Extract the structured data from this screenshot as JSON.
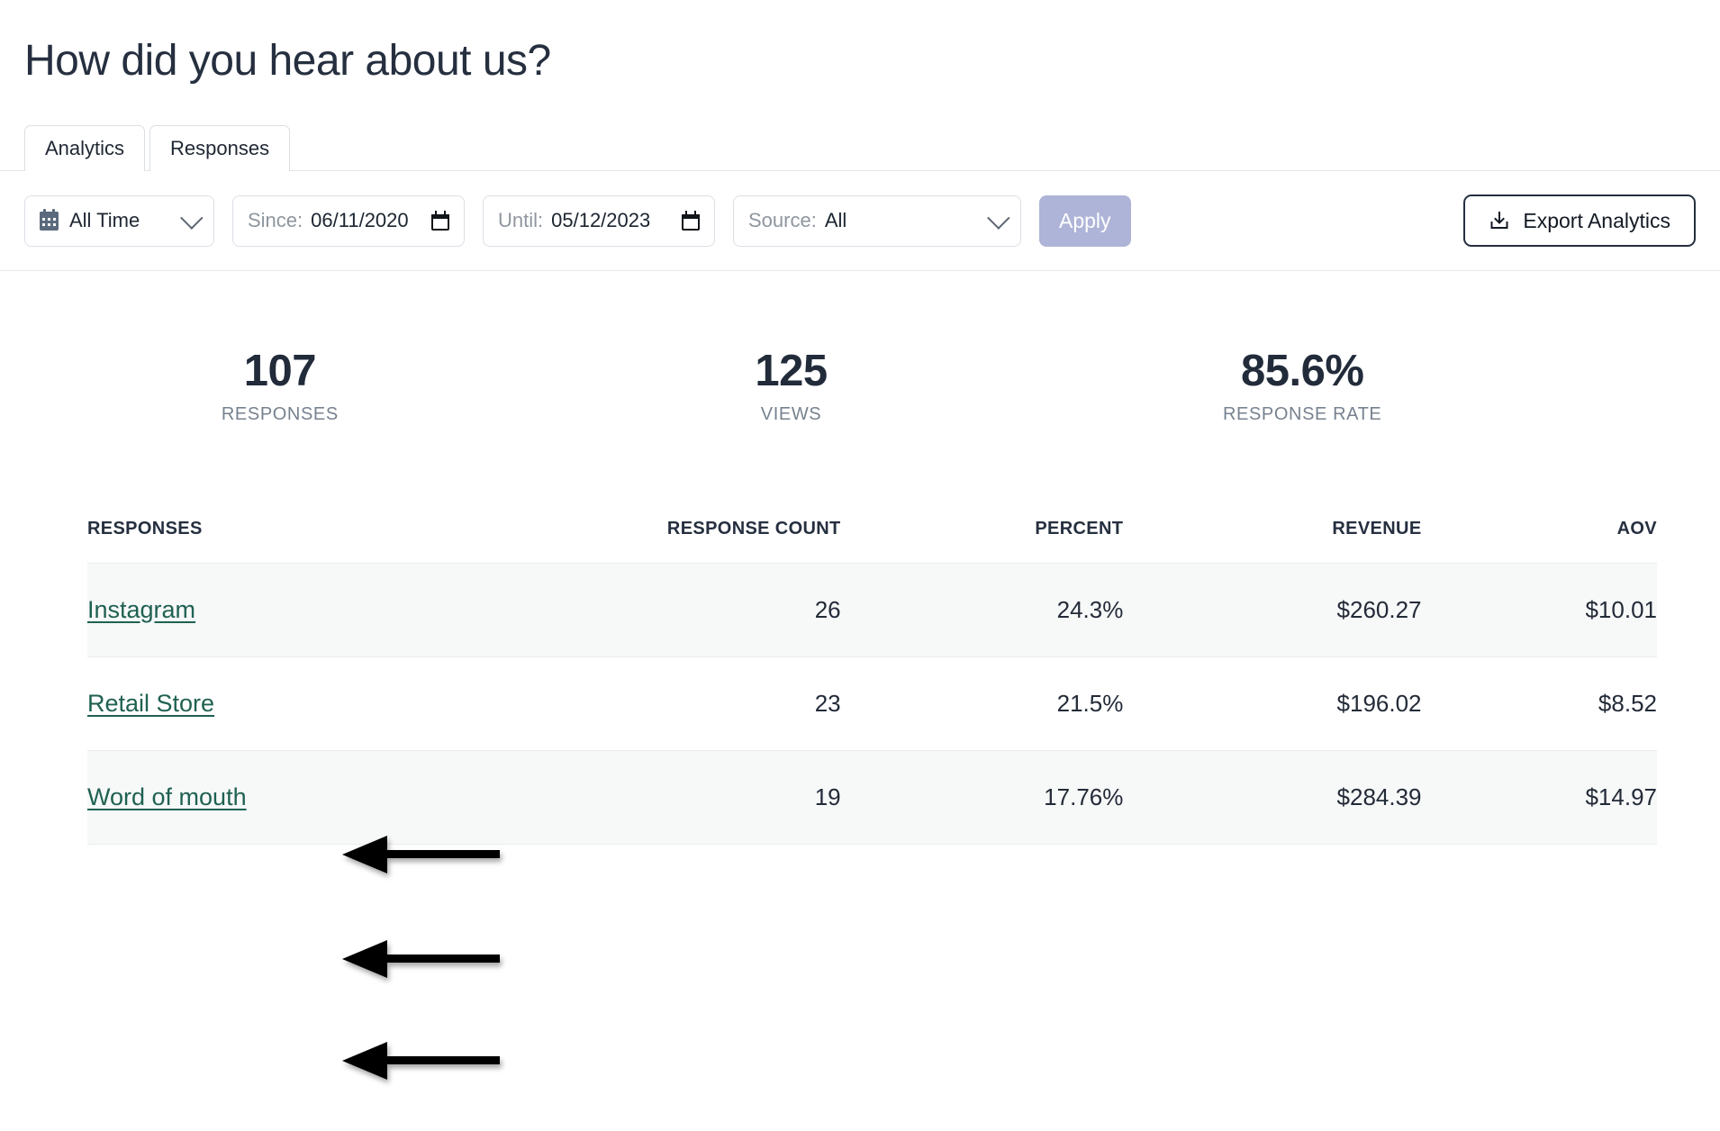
{
  "header": {
    "title": "How did you hear about us?"
  },
  "tabs": [
    {
      "label": "Analytics",
      "active": true
    },
    {
      "label": "Responses",
      "active": false
    }
  ],
  "toolbar": {
    "range_preset": "All Time",
    "calendar_icon": "calendar-icon",
    "since_label": "Since:",
    "since_value": "06/11/2020",
    "until_label": "Until:",
    "until_value": "05/12/2023",
    "source_label": "Source:",
    "source_value": "All",
    "apply_label": "Apply",
    "export_label": "Export Analytics",
    "export_icon": "download-icon",
    "apply_color": "#aeb4d7"
  },
  "stats": [
    {
      "value": "107",
      "caption": "RESPONSES"
    },
    {
      "value": "125",
      "caption": "VIEWS"
    },
    {
      "value": "85.6%",
      "caption": "RESPONSE RATE"
    }
  ],
  "table": {
    "columns": [
      "RESPONSES",
      "RESPONSE COUNT",
      "PERCENT",
      "REVENUE",
      "AOV"
    ],
    "rows": [
      {
        "response": "Instagram",
        "count": "26",
        "percent": "24.3%",
        "revenue": "$260.27",
        "aov": "$10.01"
      },
      {
        "response": "Retail Store",
        "count": "23",
        "percent": "21.5%",
        "revenue": "$196.02",
        "aov": "$8.52"
      },
      {
        "response": "Word of mouth",
        "count": "19",
        "percent": "17.76%",
        "revenue": "$284.39",
        "aov": "$14.97"
      }
    ]
  },
  "annotations": {
    "arrows": [
      {
        "target": "Instagram",
        "direction": "left"
      },
      {
        "target": "Retail Store",
        "direction": "left"
      },
      {
        "target": "Word of mouth",
        "direction": "left"
      }
    ]
  },
  "colors": {
    "link": "#1f6152",
    "text": "#232b38",
    "muted": "#77828f"
  }
}
